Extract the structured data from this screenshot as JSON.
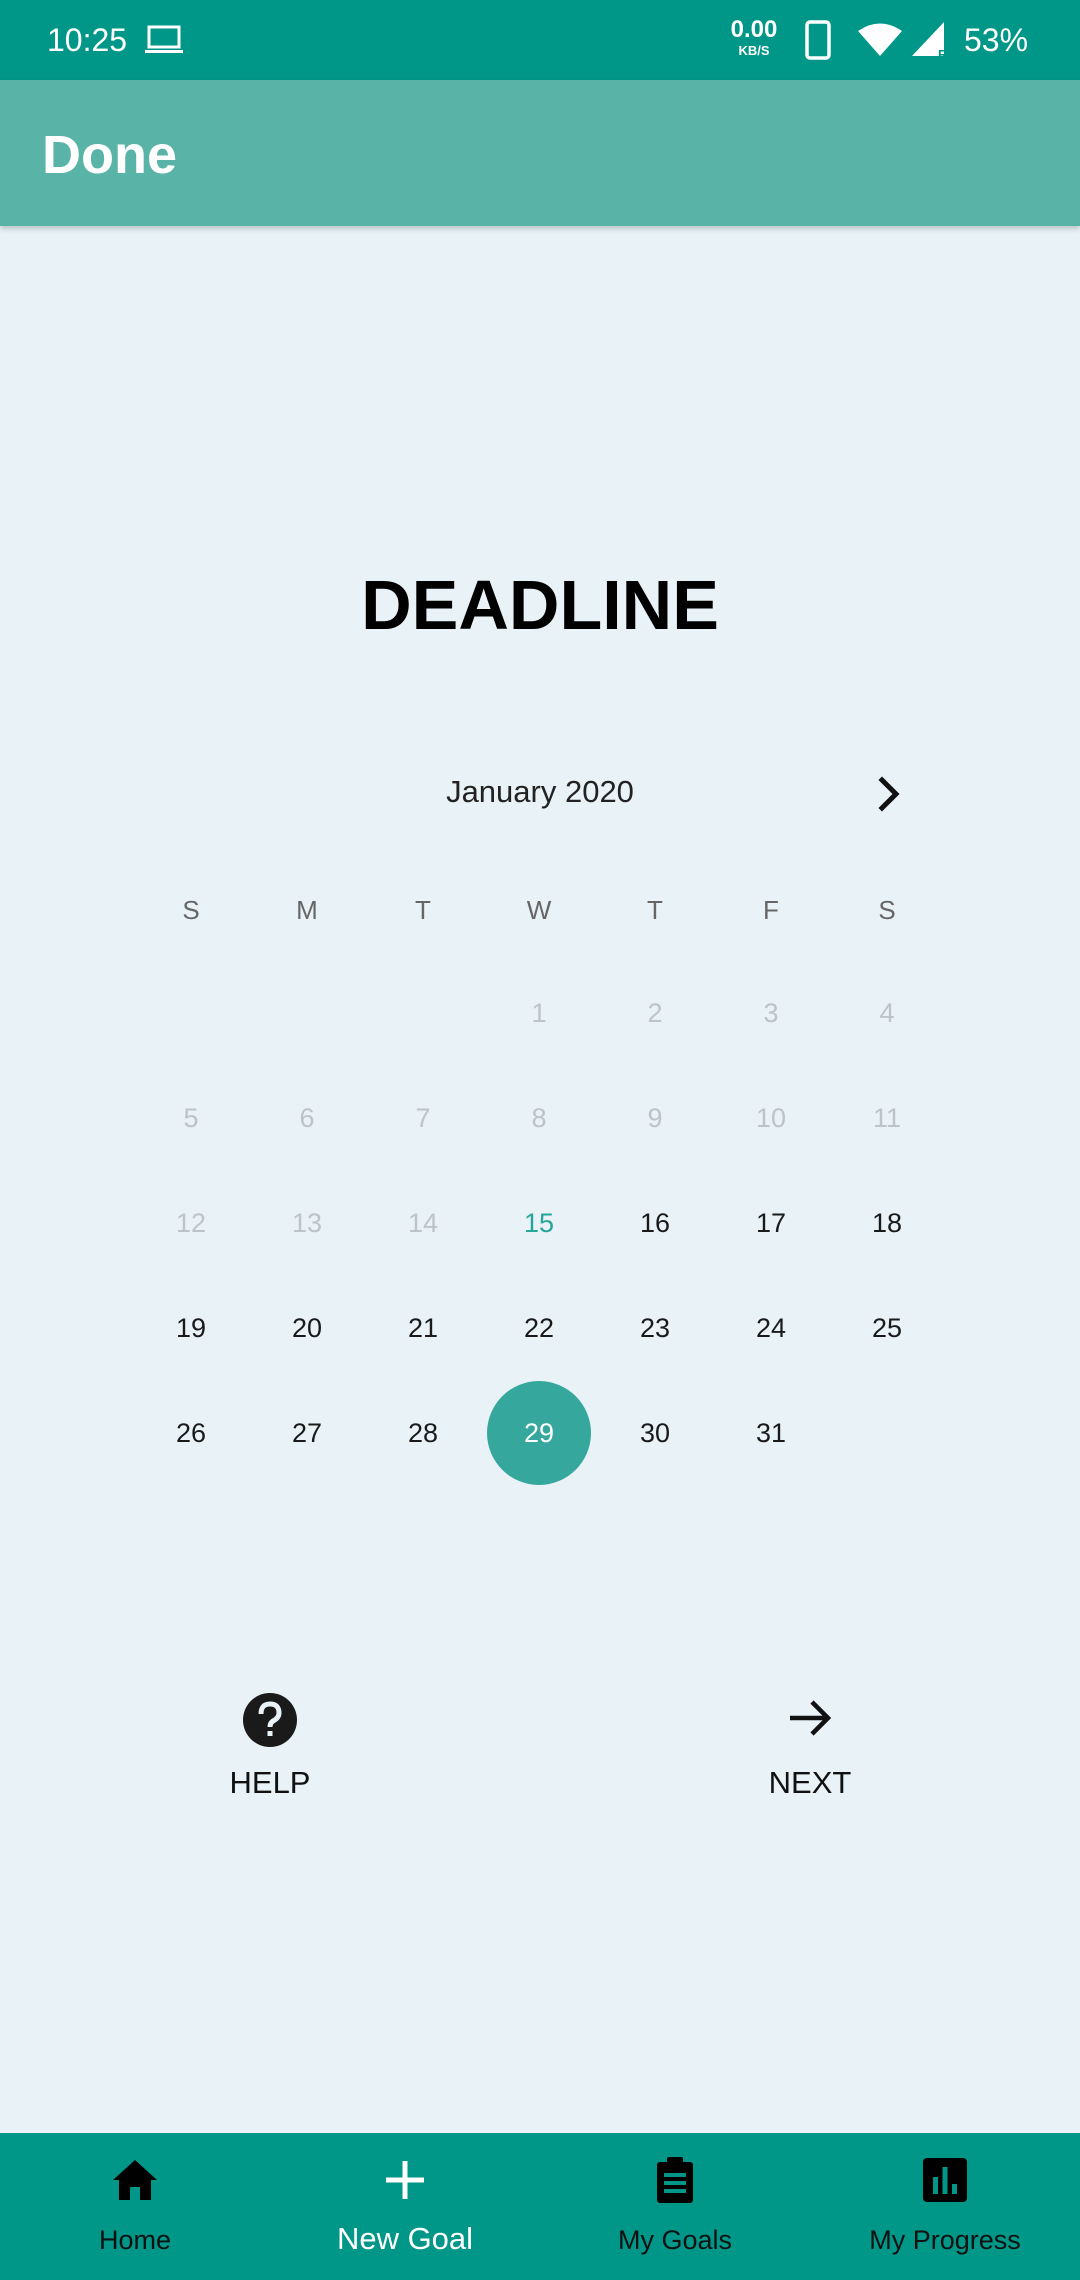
{
  "status_bar": {
    "time": "10:25",
    "net_speed": "0.00",
    "net_unit": "KB/S",
    "battery": "53%",
    "signal_label": "R",
    "icons": [
      "laptop-icon",
      "phone-icon",
      "wifi-icon",
      "signal-icon"
    ]
  },
  "app_bar": {
    "title": "Done"
  },
  "heading": "DEADLINE",
  "calendar": {
    "month_label": "January 2020",
    "next_icon": "chevron-right-icon",
    "weekdays": [
      "S",
      "M",
      "T",
      "W",
      "T",
      "F",
      "S"
    ],
    "days": [
      {
        "label": "1",
        "state": "disabled"
      },
      {
        "label": "2",
        "state": "disabled"
      },
      {
        "label": "3",
        "state": "disabled"
      },
      {
        "label": "4",
        "state": "disabled"
      },
      {
        "label": "5",
        "state": "disabled"
      },
      {
        "label": "6",
        "state": "disabled"
      },
      {
        "label": "7",
        "state": "disabled"
      },
      {
        "label": "8",
        "state": "disabled"
      },
      {
        "label": "9",
        "state": "disabled"
      },
      {
        "label": "10",
        "state": "disabled"
      },
      {
        "label": "11",
        "state": "disabled"
      },
      {
        "label": "12",
        "state": "disabled"
      },
      {
        "label": "13",
        "state": "disabled"
      },
      {
        "label": "14",
        "state": "disabled"
      },
      {
        "label": "15",
        "state": "today"
      },
      {
        "label": "16",
        "state": "normal"
      },
      {
        "label": "17",
        "state": "normal"
      },
      {
        "label": "18",
        "state": "normal"
      },
      {
        "label": "19",
        "state": "normal"
      },
      {
        "label": "20",
        "state": "normal"
      },
      {
        "label": "21",
        "state": "normal"
      },
      {
        "label": "22",
        "state": "normal"
      },
      {
        "label": "23",
        "state": "normal"
      },
      {
        "label": "24",
        "state": "normal"
      },
      {
        "label": "25",
        "state": "normal"
      },
      {
        "label": "26",
        "state": "normal"
      },
      {
        "label": "27",
        "state": "normal"
      },
      {
        "label": "28",
        "state": "normal"
      },
      {
        "label": "29",
        "state": "selected"
      },
      {
        "label": "30",
        "state": "normal"
      },
      {
        "label": "31",
        "state": "normal"
      }
    ]
  },
  "actions": {
    "help_label": "HELP",
    "help_icon": "help-circle-icon",
    "next_label": "NEXT",
    "next_icon": "arrow-right-icon"
  },
  "bottom_nav": {
    "items": [
      {
        "label": "Home",
        "icon": "home-icon",
        "active": false
      },
      {
        "label": "New Goal",
        "icon": "plus-icon",
        "active": true
      },
      {
        "label": "My Goals",
        "icon": "clipboard-icon",
        "active": false
      },
      {
        "label": "My Progress",
        "icon": "bar-chart-icon",
        "active": false
      }
    ]
  },
  "colors": {
    "status_bar": "#009688",
    "app_bar": "#5ab3a7",
    "background": "#e8f2f7",
    "selected_day": "#35a79c",
    "today": "#26a69a",
    "bottom_nav": "#009688"
  }
}
